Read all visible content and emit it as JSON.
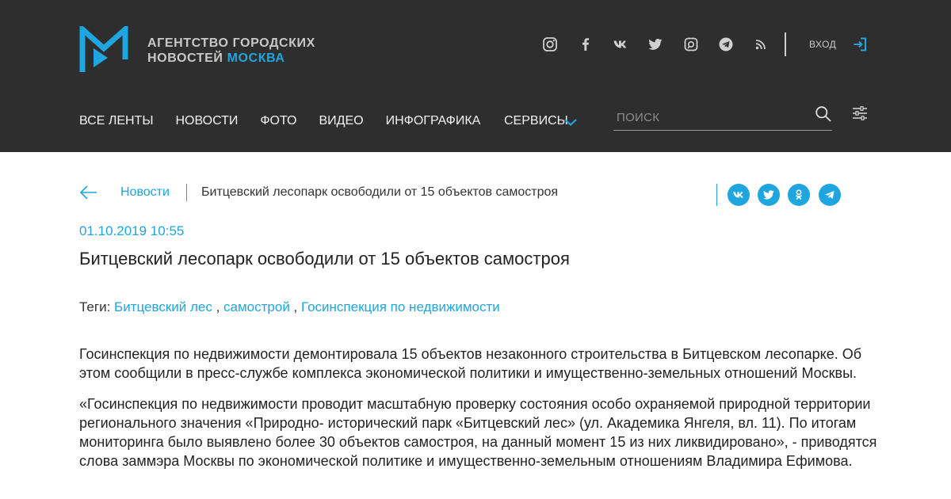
{
  "header": {
    "brand_line1": "АГЕНТСТВО ГОРОДСКИХ",
    "brand_line2_prefix": "НОВОСТЕЙ ",
    "brand_line2_accent": "МОСКВА",
    "social_icons": [
      "instagram-icon",
      "facebook-icon",
      "vk-icon",
      "twitter-icon",
      "livejournal-icon",
      "telegram-icon",
      "rss-icon"
    ],
    "login_label": "ВХОД",
    "accent_color": "#1fa5e0",
    "background_color": "#2e2e2e"
  },
  "nav": {
    "items": [
      "ВСЕ ЛЕНТЫ",
      "НОВОСТИ",
      "ФОТО",
      "ВИДЕО",
      "ИНФОГРАФИКА"
    ],
    "services_label": "СЕРВИСЫ",
    "search_placeholder": "ПОИСК"
  },
  "breadcrumb": {
    "section": "Новости",
    "current": "Битцевский лесопарк освободили от 15 объектов самостроя"
  },
  "share": [
    "vk-icon",
    "twitter-icon",
    "odnoklassniki-icon",
    "telegram-icon"
  ],
  "article": {
    "date": "01.10.2019 10:55",
    "title": "Битцевский лесопарк освободили от 15 объектов самостроя",
    "tags_label": "Теги:",
    "tags": [
      "Битцевский лес",
      "самострой",
      "Госинспекция по недвижимости"
    ],
    "tag_separator": " , ",
    "paragraphs": [
      "Госинспекция по недвижимости демонтировала 15 объектов незаконного строительства в Битцевском лесопарке. Об этом сообщили в пресс-службе комплекса экономической политики и имущественно-земельных отношений Москвы.",
      "«Госинспекция по недвижимости проводит масштабную проверку состояния особо охраняемой природной территории регионального значения «Природно- исторический парк «Битцевский лес» (ул. Академика Янгеля, вл. 11). По итогам мониторинга было выявлено более 30 объектов самостроя, на данный момент 15 из них ликвидировано», - приводятся слова заммэра Москвы по экономической политике и имущественно-земельным отношениям Владимира Ефимова."
    ]
  }
}
